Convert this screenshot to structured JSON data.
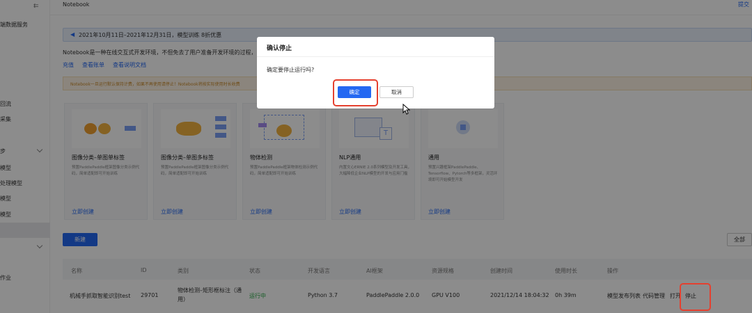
{
  "sidebar": {
    "items": [
      {
        "label": "端数据服务"
      },
      {
        "label": "回流"
      },
      {
        "label": "采集"
      },
      {
        "label": "步"
      },
      {
        "label": "模型"
      },
      {
        "label": "处理模型"
      },
      {
        "label": "模型"
      },
      {
        "label": "模型"
      },
      {
        "label": "作业"
      }
    ]
  },
  "header": {
    "title": "Notebook",
    "submit_label": "提交"
  },
  "banner": {
    "text": "2021年10月11日–2021年12月31日，模型训练 8折优惠"
  },
  "intro": {
    "text": "Notebook是一种在线交互式开发环境，不但免去了用户准备开发环境的过程，"
  },
  "links": [
    "充值",
    "查看账单",
    "查看说明文档"
  ],
  "warning": {
    "text": "Notebook一旦运行默认保持计费，如果不再使用请停止！Notebook将按实际使用时长收费"
  },
  "cards": [
    {
      "title": "图像分类–单图单标签",
      "desc": "预置PaddlePaddle框架图像分类示例代码，简单适配即可开始训练",
      "link": "立即创建"
    },
    {
      "title": "图像分类–单图多标签",
      "desc": "预置PaddlePaddle框架图像分类示例代码，简单适配即可开始训练",
      "link": "立即创建"
    },
    {
      "title": "物体检测",
      "desc": "预置PaddlePaddle框架物体检测示例代码，简单适配即可开始训练",
      "link": "立即创建"
    },
    {
      "title": "NLP通用",
      "desc": "内置文心ERNIE 2.0系列模型及开发工具，大幅降低企业NLP模型的开发与应用门槛",
      "link": "立即创建"
    },
    {
      "title": "通用",
      "desc": "预置兴趣框架PaddlePaddle、Tensorflow、Pytorch等多框架，灵活环境即可开始模型开发",
      "link": "立即创建"
    }
  ],
  "new_button": "新建",
  "filter": "全部",
  "table": {
    "headers": [
      "名称",
      "ID",
      "类别",
      "状态",
      "开发语言",
      "AI框架",
      "资源规格",
      "创建时间",
      "使用时长",
      "操作"
    ],
    "row": {
      "name": "机械手抓取智能识别test",
      "id": "29701",
      "category_1": "物体检测–矩形框标注（通",
      "category_2": "用）",
      "status": "运行中",
      "language": "Python 3.7",
      "framework": "PaddlePaddle 2.0.0",
      "resource": "GPU V100",
      "created": "2021/12/14 18:04:32",
      "duration": "0h 39m",
      "actions": [
        "模型发布列表",
        "代码管理",
        "打开",
        "停止"
      ]
    }
  },
  "modal": {
    "title": "确认停止",
    "message": "确定要停止运行吗?",
    "ok_label": "确定",
    "cancel_label": "取消"
  },
  "colors": {
    "accent": "#2468f2",
    "highlight": "#e5402f",
    "status_running": "#27a844"
  }
}
